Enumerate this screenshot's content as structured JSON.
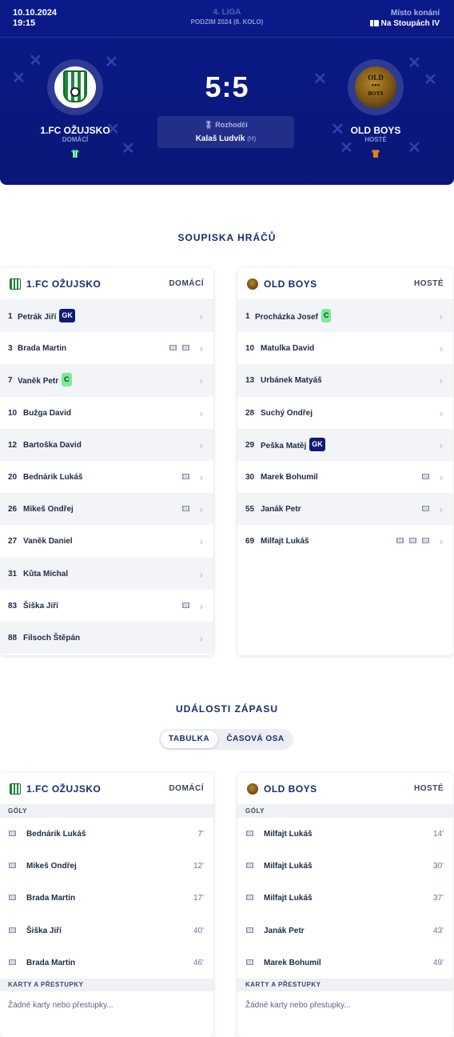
{
  "match": {
    "date": "10.10.2024",
    "time": "19:15",
    "league": "4. LIGA",
    "round": "PODZIM 2024 (8. KOLO)",
    "venue_label": "Místo konání",
    "venue": "Na Stoupách IV",
    "score": "5:5",
    "referee_label": "Rozhodčí",
    "referee_name": "Kalaš Ludvík",
    "referee_note": "(H)"
  },
  "home": {
    "name": "1.FC OŽUJSKO",
    "role": "DOMÁCÍ",
    "jersey_color": "#2ecc71"
  },
  "away": {
    "name": "OLD BOYS",
    "role": "HOSTÉ",
    "jersey_color": "#e67e22"
  },
  "away_logo": {
    "line1": "OLD",
    "line2": "BOYS"
  },
  "sections": {
    "roster_title": "SOUPISKA HRÁČŮ",
    "events_title": "UDÁLOSTI ZÁPASU",
    "card_home_team": "1.FC OŽUJSKO",
    "card_home_role": "DOMÁCÍ",
    "card_away_team": "OLD BOYS",
    "card_away_role": "HOSTÉ"
  },
  "tabs": {
    "table": "TABULKA",
    "timeline": "ČASOVÁ OSA"
  },
  "home_roster": [
    {
      "num": "1",
      "name": "Petrák Jiří",
      "badge": "GK",
      "goals": 0
    },
    {
      "num": "3",
      "name": "Brada Martin",
      "badge": "",
      "goals": 2
    },
    {
      "num": "7",
      "name": "Vaněk Petr",
      "badge": "C",
      "goals": 0
    },
    {
      "num": "10",
      "name": "Bužga David",
      "badge": "",
      "goals": 0
    },
    {
      "num": "12",
      "name": "Bartoška David",
      "badge": "",
      "goals": 0
    },
    {
      "num": "20",
      "name": "Bednárik Lukáš",
      "badge": "",
      "goals": 1
    },
    {
      "num": "26",
      "name": "Mikeš Ondřej",
      "badge": "",
      "goals": 1
    },
    {
      "num": "27",
      "name": "Vaněk Daniel",
      "badge": "",
      "goals": 0
    },
    {
      "num": "31",
      "name": "Kůta Michal",
      "badge": "",
      "goals": 0
    },
    {
      "num": "83",
      "name": "Šiška Jiří",
      "badge": "",
      "goals": 1
    },
    {
      "num": "88",
      "name": "Filsoch Štěpán",
      "badge": "",
      "goals": 0
    }
  ],
  "away_roster": [
    {
      "num": "1",
      "name": "Procházka Josef",
      "badge": "C",
      "goals": 0
    },
    {
      "num": "10",
      "name": "Matulka David",
      "badge": "",
      "goals": 0
    },
    {
      "num": "13",
      "name": "Urbánek Matyáš",
      "badge": "",
      "goals": 0
    },
    {
      "num": "28",
      "name": "Suchý Ondřej",
      "badge": "",
      "goals": 0
    },
    {
      "num": "29",
      "name": "Peška Matěj",
      "badge": "GK",
      "goals": 0
    },
    {
      "num": "30",
      "name": "Marek Bohumil",
      "badge": "",
      "goals": 1
    },
    {
      "num": "55",
      "name": "Janák Petr",
      "badge": "",
      "goals": 1
    },
    {
      "num": "69",
      "name": "Milfajt Lukáš",
      "badge": "",
      "goals": 3
    }
  ],
  "events": {
    "goals_label": "GÓLY",
    "cards_label": "KARTY A PŘESTUPKY",
    "no_cards": "Žádné karty nebo přestupky...",
    "home_goals": [
      {
        "name": "Bednárik Lukáš",
        "minute": "7'"
      },
      {
        "name": "Mikeš Ondřej",
        "minute": "12'"
      },
      {
        "name": "Brada Martin",
        "minute": "17'"
      },
      {
        "name": "Šiška Jiří",
        "minute": "40'"
      },
      {
        "name": "Brada Martin",
        "minute": "46'"
      }
    ],
    "away_goals": [
      {
        "name": "Milfajt Lukáš",
        "minute": "14'"
      },
      {
        "name": "Milfajt Lukáš",
        "minute": "30'"
      },
      {
        "name": "Milfajt Lukáš",
        "minute": "37'"
      },
      {
        "name": "Janák Petr",
        "minute": "43'"
      },
      {
        "name": "Marek Bohumil",
        "minute": "49'"
      }
    ]
  }
}
